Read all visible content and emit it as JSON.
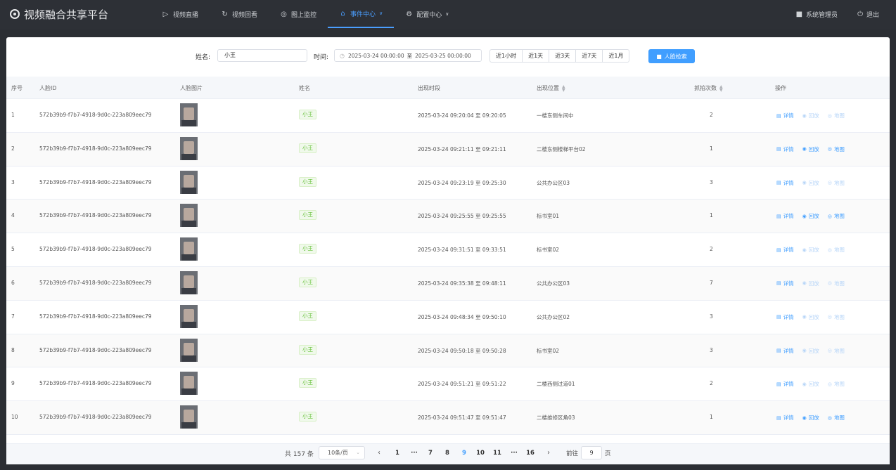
{
  "app": {
    "title": "视频融合共享平台"
  },
  "nav": [
    {
      "label": "视频直播",
      "icon": "play-circle-icon",
      "active": false,
      "caret": false
    },
    {
      "label": "视频回看",
      "icon": "refresh-icon",
      "active": false,
      "caret": false
    },
    {
      "label": "图上监控",
      "icon": "map-pin-icon",
      "active": false,
      "caret": false
    },
    {
      "label": "事件中心",
      "icon": "bell-icon",
      "active": true,
      "caret": true
    },
    {
      "label": "配置中心",
      "icon": "gear-icon",
      "active": false,
      "caret": true
    }
  ],
  "user": {
    "name": "系统管理员",
    "logout": "退出"
  },
  "filters": {
    "name_label": "姓名:",
    "name_value": "小王",
    "time_label": "时间:",
    "start": "2025-03-24 00:00:00",
    "range_sep": "至",
    "end": "2025-03-25 00:00:00",
    "quick_ranges": [
      "近1小时",
      "近1天",
      "近3天",
      "近7天",
      "近1月"
    ],
    "search_button": "人脸检索"
  },
  "table": {
    "headers": {
      "index": "序号",
      "face_id": "人脸ID",
      "face_image": "人脸图片",
      "name": "姓名",
      "time": "出现时段",
      "location": "出现位置",
      "count": "抓拍次数",
      "ops": "操作"
    },
    "op_labels": {
      "detail": "详情",
      "playback": "回放",
      "map": "地图"
    },
    "rows": [
      {
        "index": "1",
        "face_id": "572b39b9-f7b7-4918-9d0c-223a809eec79",
        "name": "小王",
        "time": "2025-03-24 09:20:04 至 09:20:05",
        "location": "一楼东侧车间中",
        "count": "2",
        "playback_enabled": false,
        "map_enabled": false
      },
      {
        "index": "2",
        "face_id": "572b39b9-f7b7-4918-9d0c-223a809eec79",
        "name": "小王",
        "time": "2025-03-24 09:21:11 至 09:21:11",
        "location": "二楼东侧楼梯平台02",
        "count": "1",
        "playback_enabled": true,
        "map_enabled": true
      },
      {
        "index": "3",
        "face_id": "572b39b9-f7b7-4918-9d0c-223a809eec79",
        "name": "小王",
        "time": "2025-03-24 09:23:19 至 09:25:30",
        "location": "公共办公区03",
        "count": "3",
        "playback_enabled": false,
        "map_enabled": false
      },
      {
        "index": "4",
        "face_id": "572b39b9-f7b7-4918-9d0c-223a809eec79",
        "name": "小王",
        "time": "2025-03-24 09:25:55 至 09:25:55",
        "location": "标书室01",
        "count": "1",
        "playback_enabled": true,
        "map_enabled": true
      },
      {
        "index": "5",
        "face_id": "572b39b9-f7b7-4918-9d0c-223a809eec79",
        "name": "小王",
        "time": "2025-03-24 09:31:51 至 09:33:51",
        "location": "标书室02",
        "count": "2",
        "playback_enabled": false,
        "map_enabled": false
      },
      {
        "index": "6",
        "face_id": "572b39b9-f7b7-4918-9d0c-223a809eec79",
        "name": "小王",
        "time": "2025-03-24 09:35:38 至 09:48:11",
        "location": "公共办公区03",
        "count": "7",
        "playback_enabled": false,
        "map_enabled": false
      },
      {
        "index": "7",
        "face_id": "572b39b9-f7b7-4918-9d0c-223a809eec79",
        "name": "小王",
        "time": "2025-03-24 09:48:34 至 09:50:10",
        "location": "公共办公区02",
        "count": "3",
        "playback_enabled": false,
        "map_enabled": false
      },
      {
        "index": "8",
        "face_id": "572b39b9-f7b7-4918-9d0c-223a809eec79",
        "name": "小王",
        "time": "2025-03-24 09:50:18 至 09:50:28",
        "location": "标书室02",
        "count": "3",
        "playback_enabled": false,
        "map_enabled": false
      },
      {
        "index": "9",
        "face_id": "572b39b9-f7b7-4918-9d0c-223a809eec79",
        "name": "小王",
        "time": "2025-03-24 09:51:21 至 09:51:22",
        "location": "二楼西侧过道01",
        "count": "2",
        "playback_enabled": false,
        "map_enabled": false
      },
      {
        "index": "10",
        "face_id": "572b39b9-f7b7-4918-9d0c-223a809eec79",
        "name": "小王",
        "time": "2025-03-24 09:51:47 至 09:51:47",
        "location": "二楼维修区角03",
        "count": "1",
        "playback_enabled": true,
        "map_enabled": true
      }
    ]
  },
  "pagination": {
    "total": "共 157 条",
    "page_size": "10条/页",
    "pages": [
      "1",
      "···",
      "7",
      "8",
      "9",
      "10",
      "11",
      "···",
      "16"
    ],
    "current": "9",
    "goto_label": "前往",
    "goto_value": "9",
    "goto_unit": "页"
  },
  "colors": {
    "accent": "#409eff",
    "topbar": "#2d3036",
    "tag_green": "#67c23a"
  }
}
